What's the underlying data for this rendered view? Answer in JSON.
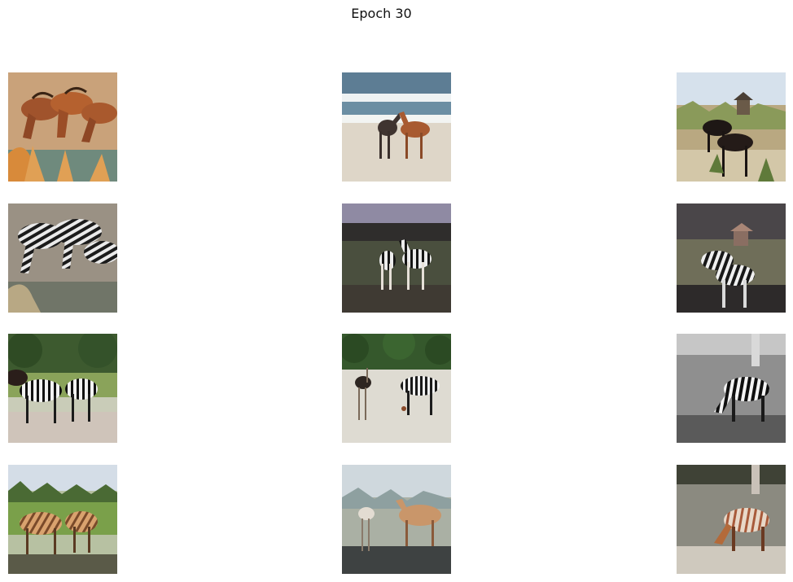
{
  "figure": {
    "title": "Epoch 30",
    "layout": {
      "rows": 4,
      "cols": 3
    },
    "panels": [
      {
        "row": 1,
        "col": 1,
        "content": "horses-drinking-water"
      },
      {
        "row": 1,
        "col": 2,
        "content": "two-horses-on-beach"
      },
      {
        "row": 1,
        "col": 3,
        "content": "two-dark-horses-grazing-by-gazebo"
      },
      {
        "row": 2,
        "col": 1,
        "content": "zebras-drinking-water-translated"
      },
      {
        "row": 2,
        "col": 2,
        "content": "two-zebras-on-beach-translated"
      },
      {
        "row": 2,
        "col": 3,
        "content": "zebras-grazing-by-gazebo-translated"
      },
      {
        "row": 3,
        "col": 1,
        "content": "zebras-grazing-under-trees"
      },
      {
        "row": 3,
        "col": 2,
        "content": "zebras-and-ostrich-on-sand"
      },
      {
        "row": 3,
        "col": 3,
        "content": "zebra-grazing-grayscale"
      },
      {
        "row": 4,
        "col": 1,
        "content": "horse-like-zebras-translated"
      },
      {
        "row": 4,
        "col": 2,
        "content": "horse-like-animals-on-sand-translated"
      },
      {
        "row": 4,
        "col": 3,
        "content": "horse-like-zebra-grazing-translated"
      }
    ]
  }
}
